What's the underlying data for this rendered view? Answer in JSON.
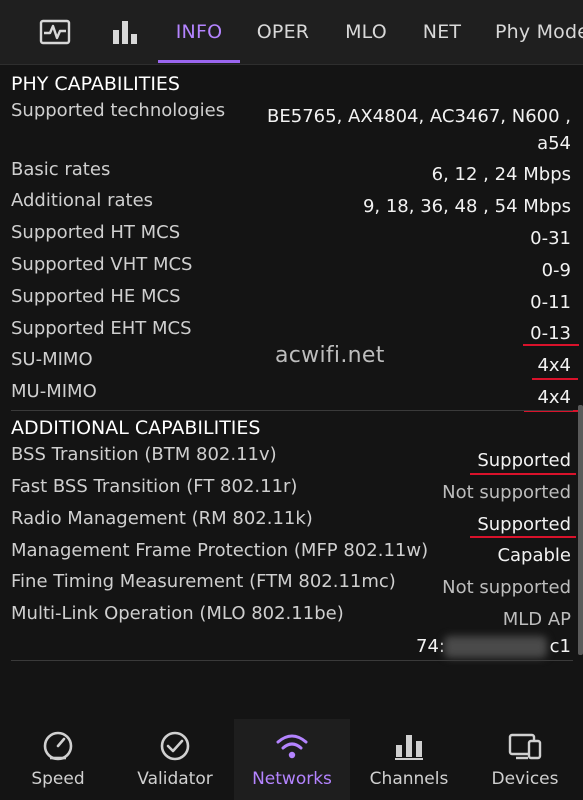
{
  "top_tabs": [
    {
      "icon": "activity-icon"
    },
    {
      "icon": "bar-chart-icon"
    },
    {
      "label": "INFO",
      "active": true
    },
    {
      "label": "OPER"
    },
    {
      "label": "MLO"
    },
    {
      "label": "NET"
    },
    {
      "label": "Phy Mode"
    }
  ],
  "phy": {
    "title": "PHY CAPABILITIES",
    "rows": [
      {
        "label": "Supported technologies",
        "value_line1": "BE5765, AX4804, AC3467, N600 ,",
        "value_line2": "a54"
      },
      {
        "label": "Basic rates",
        "value": "6, 12 , 24 Mbps"
      },
      {
        "label": "Additional rates",
        "value": "9, 18, 36, 48 , 54 Mbps"
      },
      {
        "label": "Supported HT MCS",
        "value": "0-31"
      },
      {
        "label": "Supported VHT MCS",
        "value": "0-9"
      },
      {
        "label": "Supported HE MCS",
        "value": "0-11"
      },
      {
        "label": "Supported EHT MCS",
        "value": "0-13"
      },
      {
        "label": "SU-MIMO",
        "value": "4x4"
      },
      {
        "label": "MU-MIMO",
        "value": "4x4"
      }
    ]
  },
  "additional": {
    "title": "ADDITIONAL CAPABILITIES",
    "rows": [
      {
        "label": "BSS Transition (BTM 802.11v)",
        "value": "Supported"
      },
      {
        "label": "Fast BSS Transition (FT 802.11r)",
        "value": "Not supported"
      },
      {
        "label": "Radio Management (RM 802.11k)",
        "value": "Supported"
      },
      {
        "label": "Management Frame Protection (MFP 802.11w)",
        "value": "Capable"
      },
      {
        "label": "Fine Timing Measurement (FTM 802.11mc)",
        "value": "Not supported"
      },
      {
        "label": "Multi-Link Operation (MLO 802.11be)",
        "value": "MLD AP"
      }
    ],
    "mac_prefix": "74:",
    "mac_suffix": "c1"
  },
  "watermark": "acwifi.net",
  "colors": {
    "accent": "#b484ff",
    "highlight": "#d9122b",
    "background": "#141414"
  },
  "bottom_nav": [
    {
      "label": "Speed",
      "icon": "speedometer-icon"
    },
    {
      "label": "Validator",
      "icon": "check-circle-icon"
    },
    {
      "label": "Networks",
      "icon": "wifi-icon",
      "active": true
    },
    {
      "label": "Channels",
      "icon": "channels-icon"
    },
    {
      "label": "Devices",
      "icon": "devices-icon"
    }
  ]
}
